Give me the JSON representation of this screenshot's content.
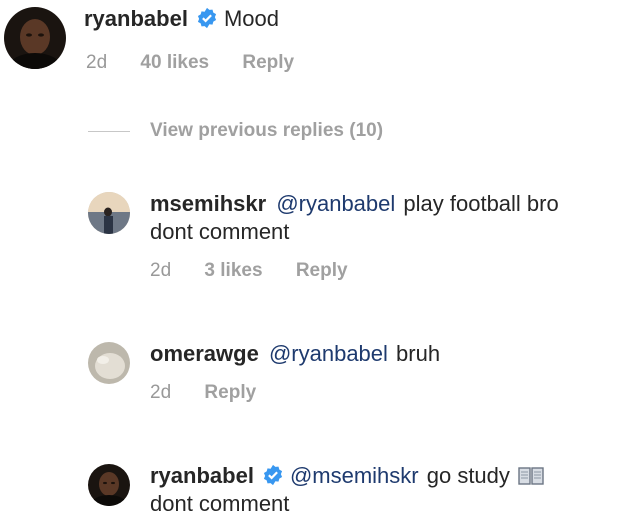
{
  "comments": [
    {
      "username": "ryanbabel",
      "verified": true,
      "mention": "",
      "text": "Mood",
      "text_line2": "",
      "time": "2d",
      "likes": "40 likes",
      "reply": "Reply"
    }
  ],
  "view_previous": "View previous replies (10)",
  "replies": [
    {
      "username": "msemihskr",
      "verified": false,
      "mention": "@ryanbabel",
      "text": "play football bro",
      "text_line2": "dont comment",
      "time": "2d",
      "likes": "3 likes",
      "reply": "Reply"
    },
    {
      "username": "omerawge",
      "verified": false,
      "mention": "@ryanbabel",
      "text": "bruh",
      "text_line2": "",
      "time": "2d",
      "likes": "",
      "reply": "Reply"
    },
    {
      "username": "ryanbabel",
      "verified": true,
      "mention": "@msemihskr",
      "text": "go study",
      "text_line2": "dont comment",
      "emoji": "open-book-icon"
    }
  ],
  "colors": {
    "verified_badge": "#3897f0",
    "mention": "#1e3a6e",
    "meta": "#999999"
  }
}
